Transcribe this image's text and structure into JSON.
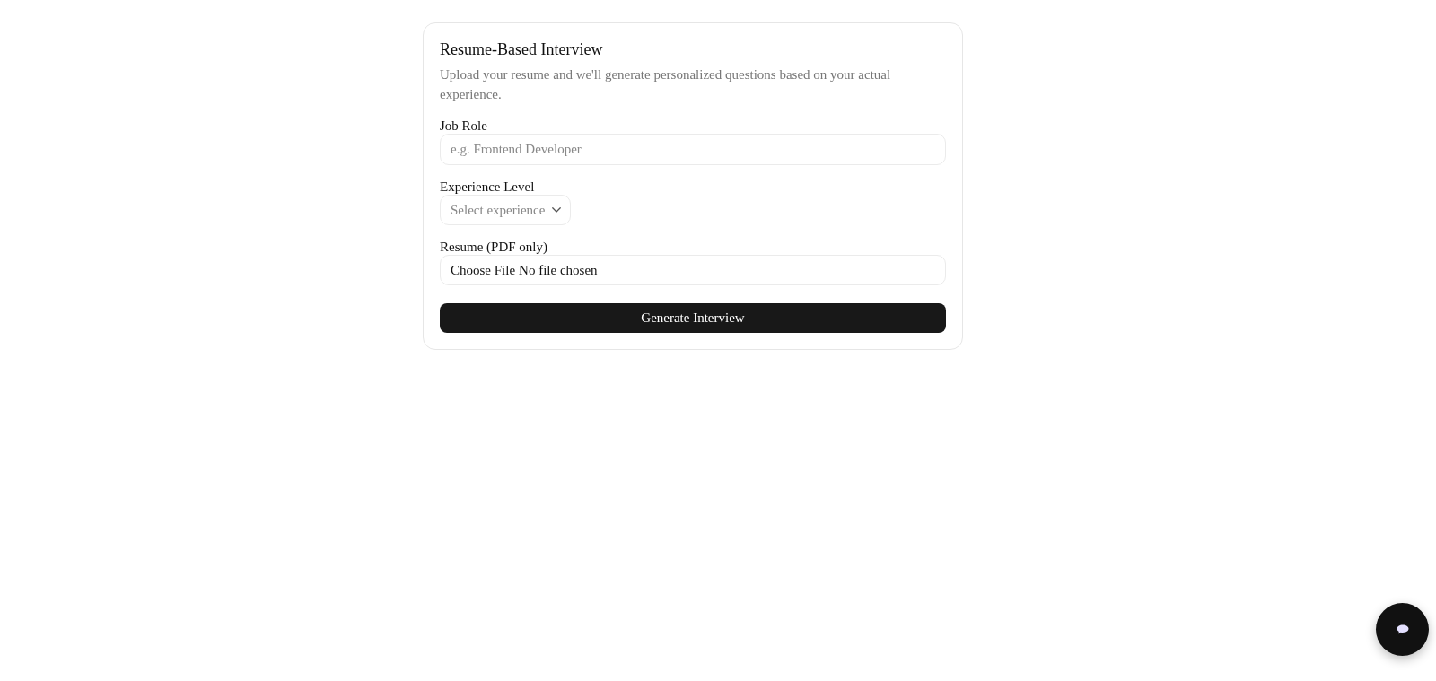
{
  "form": {
    "title": "Resume-Based Interview",
    "description": "Upload your resume and we'll generate personalized questions based on your actual experience.",
    "fields": [
      {
        "kind": "text",
        "label": "Job Role",
        "placeholder": "e.g. Frontend Developer"
      },
      {
        "kind": "select",
        "label": "Experience Level",
        "placeholder": "Select experience"
      },
      {
        "kind": "file",
        "label": "Resume (PDF only)",
        "button": "Choose File",
        "status": "No file chosen"
      }
    ],
    "submit": "Generate Interview"
  }
}
